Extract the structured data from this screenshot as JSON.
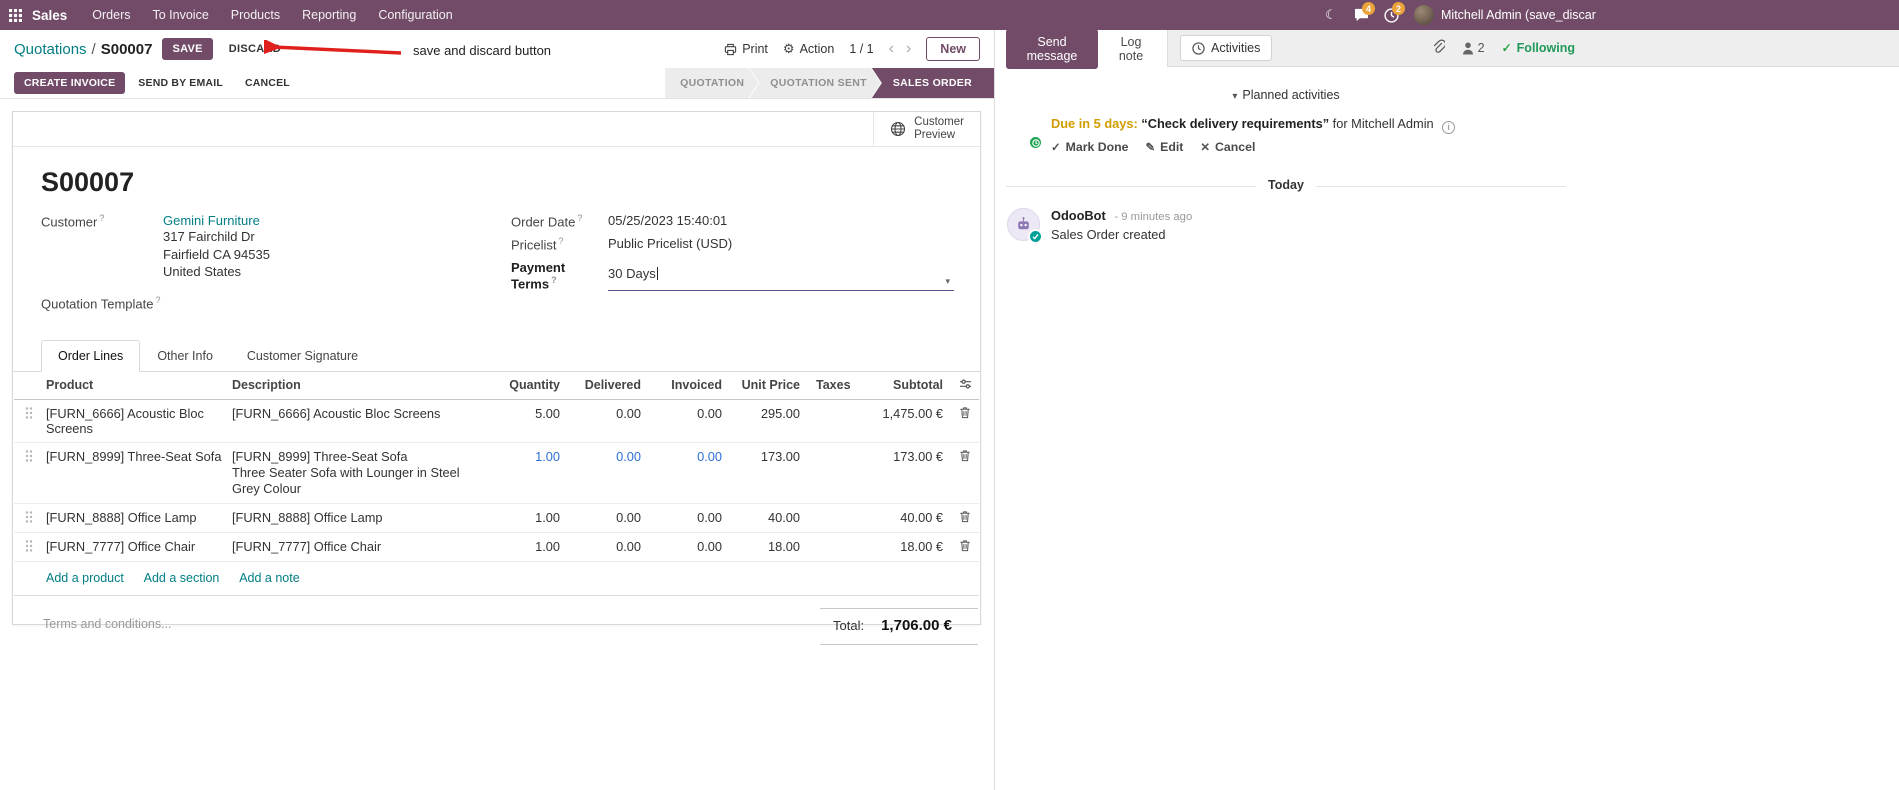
{
  "navbar": {
    "app_name": "Sales",
    "menus": [
      "Orders",
      "To Invoice",
      "Products",
      "Reporting",
      "Configuration"
    ],
    "messages_badge": "4",
    "activities_badge": "2",
    "user_name": "Mitchell Admin (save_discar"
  },
  "control": {
    "breadcrumb_parent": "Quotations",
    "separator": "/",
    "breadcrumb_current": "S00007",
    "save": "SAVE",
    "discard": "DISCARD",
    "annotation": "save and discard button",
    "print": "Print",
    "action": "Action",
    "pager": "1 / 1",
    "new": "New"
  },
  "statusbar": {
    "create_invoice": "CREATE INVOICE",
    "send_by_email": "SEND BY EMAIL",
    "cancel": "CANCEL",
    "stages": [
      {
        "label": "QUOTATION",
        "active": false
      },
      {
        "label": "QUOTATION SENT",
        "active": false
      },
      {
        "label": "SALES ORDER",
        "active": true
      }
    ]
  },
  "sheet": {
    "help_marker": "?",
    "preview": {
      "line1": "Customer",
      "line2": "Preview"
    },
    "title": "S00007",
    "fields": {
      "customer_label": "Customer",
      "customer_value": "Gemini Furniture",
      "address": [
        "317 Fairchild Dr",
        "Fairfield CA 94535",
        "United States"
      ],
      "quotation_template_label": "Quotation Template",
      "order_date_label": "Order Date",
      "order_date_value": "05/25/2023 15:40:01",
      "pricelist_label": "Pricelist",
      "pricelist_value": "Public Pricelist (USD)",
      "payment_terms_label": "Payment Terms",
      "payment_terms_value": "30 Days"
    },
    "tabs": [
      {
        "label": "Order Lines"
      },
      {
        "label": "Other Info"
      },
      {
        "label": "Customer Signature"
      }
    ],
    "order_lines": {
      "headers": [
        "Product",
        "Description",
        "Quantity",
        "Delivered",
        "Invoiced",
        "Unit Price",
        "Taxes",
        "Subtotal"
      ],
      "rows": [
        {
          "product": "[FURN_6666] Acoustic Bloc Screens",
          "description": "[FURN_6666] Acoustic Bloc Screens",
          "description2": "",
          "quantity": "5.00",
          "delivered": "0.00",
          "invoiced": "0.00",
          "unit_price": "295.00",
          "taxes": "",
          "subtotal": "1,475.00 €"
        },
        {
          "product": "[FURN_8999] Three-Seat Sofa",
          "description": "[FURN_8999] Three-Seat Sofa",
          "description2": "Three Seater Sofa with Lounger in Steel Grey Colour",
          "quantity": "1.00",
          "delivered": "0.00",
          "invoiced": "0.00",
          "unit_price": "173.00",
          "taxes": "",
          "subtotal": "173.00 €"
        },
        {
          "product": "[FURN_8888] Office Lamp",
          "description": "[FURN_8888] Office Lamp",
          "description2": "",
          "quantity": "1.00",
          "delivered": "0.00",
          "invoiced": "0.00",
          "unit_price": "40.00",
          "taxes": "",
          "subtotal": "40.00 €"
        },
        {
          "product": "[FURN_7777] Office Chair",
          "description": "[FURN_7777] Office Chair",
          "description2": "",
          "quantity": "1.00",
          "delivered": "0.00",
          "invoiced": "0.00",
          "unit_price": "18.00",
          "taxes": "",
          "subtotal": "18.00 €"
        }
      ],
      "footer_links": [
        "Add a product",
        "Add a section",
        "Add a note"
      ]
    },
    "terms_placeholder": "Terms and conditions...",
    "total_label": "Total:",
    "total_value": "1,706.00 €"
  },
  "chatter": {
    "send_message": "Send message",
    "log_note": "Log note",
    "activities": "Activities",
    "followers_count": "2",
    "following": "Following",
    "planned_header": "Planned activities",
    "activity": {
      "due": "Due in 5 days:",
      "summary": "“Check delivery requirements”",
      "for_user": "for Mitchell Admin",
      "mark_done": "Mark Done",
      "edit": "Edit",
      "cancel": "Cancel"
    },
    "today": "Today",
    "message": {
      "author": "OdooBot",
      "time": "- 9 minutes ago",
      "body": "Sales Order created"
    }
  },
  "icons": {
    "moon": "☾",
    "gear": "⚙",
    "chevron_left": "‹",
    "chevron_right": "›",
    "caret_down": "▾",
    "check": "✓",
    "pencil": "✎",
    "cross": "✕",
    "info": "i"
  },
  "colors": {
    "brand": "#714B67",
    "link": "#017e84",
    "edited_value": "#2e6fd6",
    "badge": "#eaa43b",
    "annotation_arrow": "#e0201c",
    "success": "#28a745"
  }
}
